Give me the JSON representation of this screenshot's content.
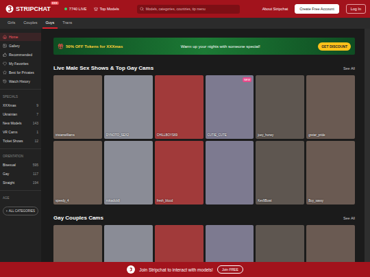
{
  "header": {
    "logo": "STRIPCHAT",
    "logo_badge": "XXX",
    "live_count": "7740 LIVE",
    "top_models": "Top Models",
    "search_placeholder": "Models, categories, countries, tip menu",
    "about": "About Stripchat",
    "create_account": "Create Free Account",
    "login": "Log In"
  },
  "tabs": [
    {
      "label": "Girls",
      "selected": false
    },
    {
      "label": "Couples",
      "selected": false
    },
    {
      "label": "Guys",
      "selected": true
    },
    {
      "label": "Trans",
      "selected": false
    }
  ],
  "sidebar": {
    "items": [
      {
        "label": "Home",
        "selected": true
      },
      {
        "label": "Gallery",
        "selected": false
      },
      {
        "label": "Recommended",
        "selected": false
      },
      {
        "label": "My Favorites",
        "selected": false
      },
      {
        "label": "Best for Privates",
        "selected": false
      },
      {
        "label": "Watch History",
        "selected": false
      }
    ],
    "groups": [
      {
        "title": "SPECIALS",
        "items": [
          {
            "label": "XXXmas",
            "count": "9"
          },
          {
            "label": "Ukrainian",
            "count": "7"
          },
          {
            "label": "New Models",
            "count": "143"
          },
          {
            "label": "VR Cams",
            "count": "1"
          },
          {
            "label": "Ticket Shows",
            "count": "12"
          }
        ]
      },
      {
        "title": "ORIENTATION",
        "items": [
          {
            "label": "Bisexual",
            "count": "595"
          },
          {
            "label": "Gay",
            "count": "117"
          },
          {
            "label": "Straight",
            "count": "194"
          }
        ]
      },
      {
        "title": "AGE",
        "items": []
      }
    ],
    "all_categories": "ALL CATEGORIES"
  },
  "banner": {
    "offer": "50% OFF Tokens for XXXmas",
    "tagline": "Warm up your nights with someone special!",
    "button": "GET DISCOUNT"
  },
  "sections": [
    {
      "title": "Live Male Sex Shows & Top Gay Cams",
      "see_all": "See All",
      "new_label": "NEW",
      "cards": [
        {
          "name": "tristanwilliams",
          "new": false
        },
        {
          "name": "DYNOTO_SEX2",
          "new": false
        },
        {
          "name": "CHILLBOYS69",
          "new": false
        },
        {
          "name": "CUTIE_CUTE",
          "new": true
        },
        {
          "name": "joey_honey",
          "new": false
        },
        {
          "name": "gretar_pride",
          "new": false
        },
        {
          "name": "speedy_4",
          "new": false
        },
        {
          "name": "mikadick8",
          "new": false
        },
        {
          "name": "fresh_blood",
          "new": false
        },
        {
          "new": false
        },
        {
          "name": "Kev9Bowt",
          "new": false
        },
        {
          "name": "Boy_sassy",
          "new": false
        }
      ]
    },
    {
      "title": "Gay Couples Cams",
      "see_all": "See All",
      "new_label": "NEW",
      "cards": [
        {
          "new": false
        },
        {
          "new": false
        },
        {
          "new": false
        },
        {
          "new": false
        },
        {
          "new": false
        },
        {
          "new": false
        }
      ]
    }
  ],
  "join_bar": {
    "text": "Join Stripchat to interact with models!",
    "button": "Join FREE"
  }
}
